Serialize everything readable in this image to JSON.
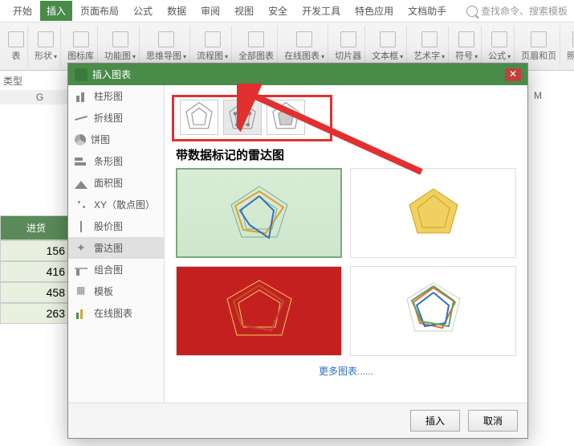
{
  "menubar": {
    "items": [
      "开始",
      "插入",
      "页面布局",
      "公式",
      "数据",
      "审阅",
      "视图",
      "安全",
      "开发工具",
      "特色应用",
      "文档助手"
    ],
    "active_index": 1,
    "search_placeholder": "查找命令、搜索模板"
  },
  "ribbon": {
    "groups": [
      {
        "label": "表",
        "name": "table"
      },
      {
        "label": "形状",
        "name": "shapes"
      },
      {
        "label": "图标库",
        "name": "icon-lib"
      },
      {
        "label": "功能图",
        "name": "func-chart"
      },
      {
        "label": "思维导图",
        "name": "mindmap"
      },
      {
        "label": "流程图",
        "name": "flowchart"
      },
      {
        "label": "全部图表",
        "name": "all-charts"
      },
      {
        "label": "在线图表",
        "name": "online-charts"
      },
      {
        "label": "",
        "name": "sparkline"
      },
      {
        "label": "切片器",
        "name": "slicer"
      },
      {
        "label": "文本框",
        "name": "textbox"
      },
      {
        "label": "艺术字",
        "name": "wordart"
      },
      {
        "label": "符号",
        "name": "symbol"
      },
      {
        "label": "公式",
        "name": "formula"
      },
      {
        "label": "页眉和页",
        "name": "header-footer"
      },
      {
        "label": "照相机",
        "name": "camera"
      }
    ]
  },
  "sheet": {
    "row_label": "类型",
    "cols": [
      "G"
    ],
    "col_right": "M",
    "data_header": "进货",
    "data_values": [
      "156",
      "416",
      "458",
      "263"
    ]
  },
  "dialog": {
    "title": "插入图表",
    "chart_types": [
      {
        "key": "bar",
        "label": "柱形图"
      },
      {
        "key": "line",
        "label": "折线图"
      },
      {
        "key": "pie",
        "label": "饼图"
      },
      {
        "key": "hbar",
        "label": "条形图"
      },
      {
        "key": "area",
        "label": "面积图"
      },
      {
        "key": "scatter",
        "label": "XY（散点图）"
      },
      {
        "key": "stock",
        "label": "股价图"
      },
      {
        "key": "radar",
        "label": "雷达图"
      },
      {
        "key": "combo",
        "label": "组合图"
      },
      {
        "key": "template",
        "label": "模板"
      },
      {
        "key": "online",
        "label": "在线图表"
      }
    ],
    "selected_type_index": 7,
    "selected_subtype_index": 1,
    "subtitle": "带数据标记的雷达图",
    "more_link": "更多图表......",
    "buttons": {
      "insert": "插入",
      "cancel": "取消"
    }
  }
}
